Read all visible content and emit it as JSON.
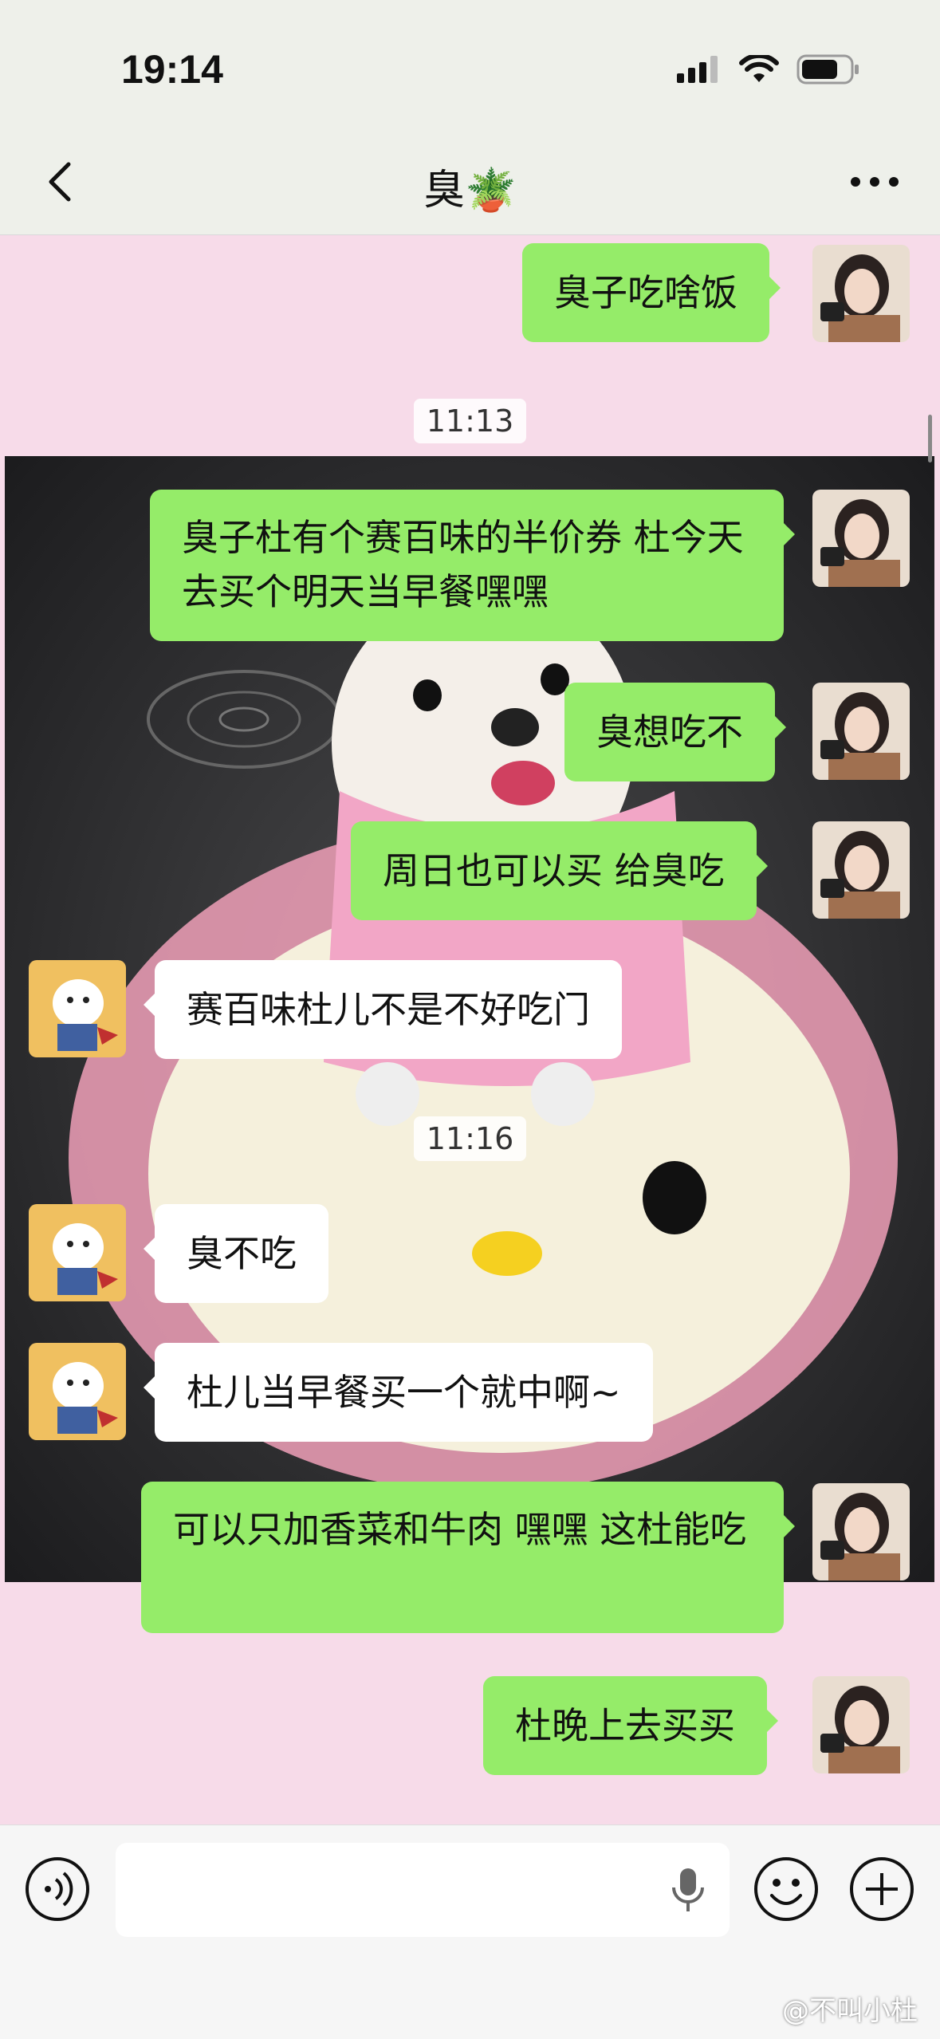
{
  "status": {
    "time": "19:14"
  },
  "chat": {
    "title": "臭🪴"
  },
  "messages": [
    {
      "from": "me",
      "text": "臭子吃啥饭"
    },
    {
      "type": "time",
      "text": "11:13"
    },
    {
      "from": "me",
      "text": "臭子杜有个赛百味的半价券 杜今天去买个明天当早餐嘿嘿"
    },
    {
      "from": "me",
      "text": "臭想吃不"
    },
    {
      "from": "me",
      "text": "周日也可以买 给臭吃"
    },
    {
      "from": "other",
      "text": "赛百味杜儿不是不好吃门"
    },
    {
      "type": "time",
      "text": "11:16"
    },
    {
      "from": "other",
      "text": "臭不吃"
    },
    {
      "from": "other",
      "text": "杜儿当早餐买一个就中啊~"
    },
    {
      "from": "me",
      "text": "可以只加香菜和牛肉 嘿嘿 这杜能吃"
    },
    {
      "from": "me",
      "text": "杜晚上去买买"
    }
  ],
  "watermark": "@不叫小杜",
  "icons": [
    "back-icon",
    "more-icon",
    "voice-icon",
    "microphone-icon",
    "emoji-icon",
    "plus-icon"
  ]
}
